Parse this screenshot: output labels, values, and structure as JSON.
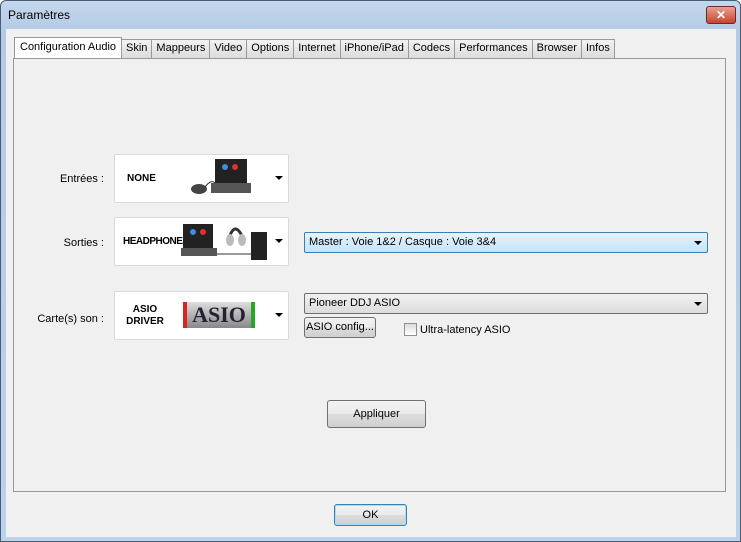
{
  "window": {
    "title": "Paramètres",
    "close": "✕"
  },
  "tabs": [
    "Configuration Audio",
    "Skin",
    "Mappeurs",
    "Video",
    "Options",
    "Internet",
    "iPhone/iPad",
    "Codecs",
    "Performances",
    "Browser",
    "Infos"
  ],
  "inputs": {
    "label": "Entrées :",
    "image_text": "NONE"
  },
  "outputs": {
    "label": "Sorties :",
    "image_text": "HEADPHONES",
    "selected": "Master : Voie 1&2 / Casque : Voie 3&4"
  },
  "soundcard": {
    "label": "Carte(s) son :",
    "image_text_1": "ASIO",
    "image_text_2": "DRIVER",
    "logo": "ASIO",
    "selected": "Pioneer DDJ ASIO",
    "config_button": "ASIO config...",
    "ultra_latency_label": "Ultra-latency ASIO",
    "ultra_latency_checked": false
  },
  "apply_button": "Appliquer",
  "ok_button": "OK"
}
